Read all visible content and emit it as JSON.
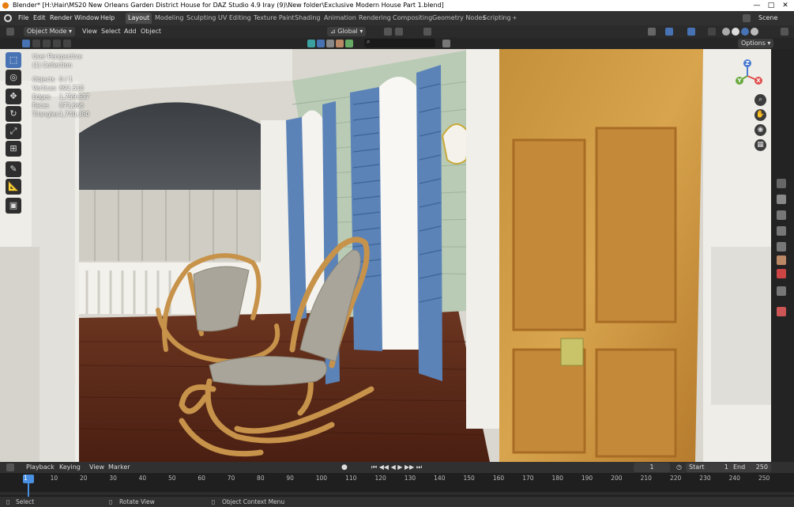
{
  "title_bar": {
    "title": "Blender* [H:\\Hair\\MS20 New Orleans Garden District House for DAZ Studio 4.9 Iray  (9)\\New folder\\Exclusive Modern House Part 1.blend]",
    "minimize": "—",
    "maximize": "□",
    "close": "✕"
  },
  "menu": {
    "items": [
      "File",
      "Edit",
      "Render",
      "Window",
      "Help"
    ],
    "workspaces": [
      "Layout",
      "Modeling",
      "Sculpting",
      "UV Editing",
      "Texture Paint",
      "Shading",
      "Animation",
      "Rendering",
      "Compositing",
      "Geometry Nodes",
      "Scripting"
    ],
    "active_workspace": "Layout",
    "add_tab": "+",
    "scene_label": "Scene"
  },
  "header": {
    "mode": "Object Mode",
    "items": [
      "View",
      "Select",
      "Add",
      "Object"
    ],
    "transform": "Global",
    "options": "Options"
  },
  "viewport": {
    "perspective": "User Perspective",
    "collection": "(1) Collection",
    "stats": [
      {
        "label": "Objects",
        "value": "0 / 1"
      },
      {
        "label": "Vertices",
        "value": "892,510"
      },
      {
        "label": "Edges",
        "value": "1,759,637"
      },
      {
        "label": "Faces",
        "value": "873,666"
      },
      {
        "label": "Triangles",
        "value": "1,740,380"
      }
    ],
    "gizmo": {
      "x": "X",
      "y": "Y",
      "z": "Z"
    }
  },
  "timeline": {
    "menus": [
      "Playback",
      "Keying",
      "View",
      "Marker"
    ],
    "current_frame": "1",
    "start_label": "Start",
    "start_value": "1",
    "end_label": "End",
    "end_value": "250",
    "ticks": [
      "1",
      "10",
      "20",
      "30",
      "40",
      "50",
      "60",
      "70",
      "80",
      "90",
      "100",
      "110",
      "120",
      "130",
      "140",
      "150",
      "160",
      "170",
      "180",
      "190",
      "200",
      "210",
      "220",
      "230",
      "240",
      "250"
    ]
  },
  "status_bar": {
    "select": "Select",
    "rotate": "Rotate View",
    "context": "Object Context Menu"
  },
  "colors": {
    "accent": "#4772b3",
    "header": "#303030",
    "frame_marker": "#4a90e2"
  }
}
